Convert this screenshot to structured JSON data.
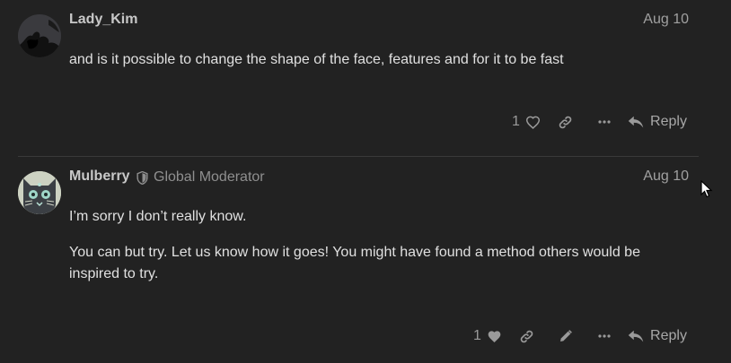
{
  "posts": [
    {
      "author": "Lady_Kim",
      "date": "Aug 10",
      "paragraphs": [
        "and is it possible to change the shape of the face, features and for it to be fast"
      ],
      "likes": "1",
      "reply_label": "Reply"
    },
    {
      "author": "Mulberry",
      "user_title": "Global Moderator",
      "date": "Aug 10",
      "paragraphs": [
        "I’m sorry I don’t really know.",
        "You can but try. Let us know how it goes! You might have found a method others would be inspired to try."
      ],
      "likes": "1",
      "reply_label": "Reply"
    }
  ],
  "icons": {
    "like": "heart-icon",
    "link": "link-icon",
    "more": "ellipsis-icon",
    "edit": "pencil-icon",
    "reply": "reply-arrow-icon",
    "moderator": "shield-icon"
  },
  "colors": {
    "background": "#222222",
    "text": "#dddddd",
    "muted": "#9a9a9a"
  }
}
